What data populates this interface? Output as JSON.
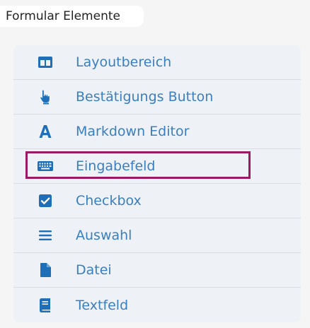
{
  "header": {
    "title": "Formular Elemente"
  },
  "colors": {
    "icon": "#1f6fb8",
    "label": "#3a7fc1",
    "selection_border": "#9b1b62",
    "panel_bg": "#eef1f5"
  },
  "items": [
    {
      "label": "Layoutbereich",
      "icon": "layout-columns-icon"
    },
    {
      "label": "Bestätigungs Button",
      "icon": "pointing-hand-icon"
    },
    {
      "label": "Markdown Editor",
      "icon": "letter-a-icon"
    },
    {
      "label": "Eingabefeld",
      "icon": "keyboard-icon",
      "selected": true
    },
    {
      "label": "Checkbox",
      "icon": "checkbox-icon"
    },
    {
      "label": "Auswahl",
      "icon": "list-lines-icon"
    },
    {
      "label": "Datei",
      "icon": "file-icon"
    },
    {
      "label": "Textfeld",
      "icon": "book-icon"
    }
  ]
}
